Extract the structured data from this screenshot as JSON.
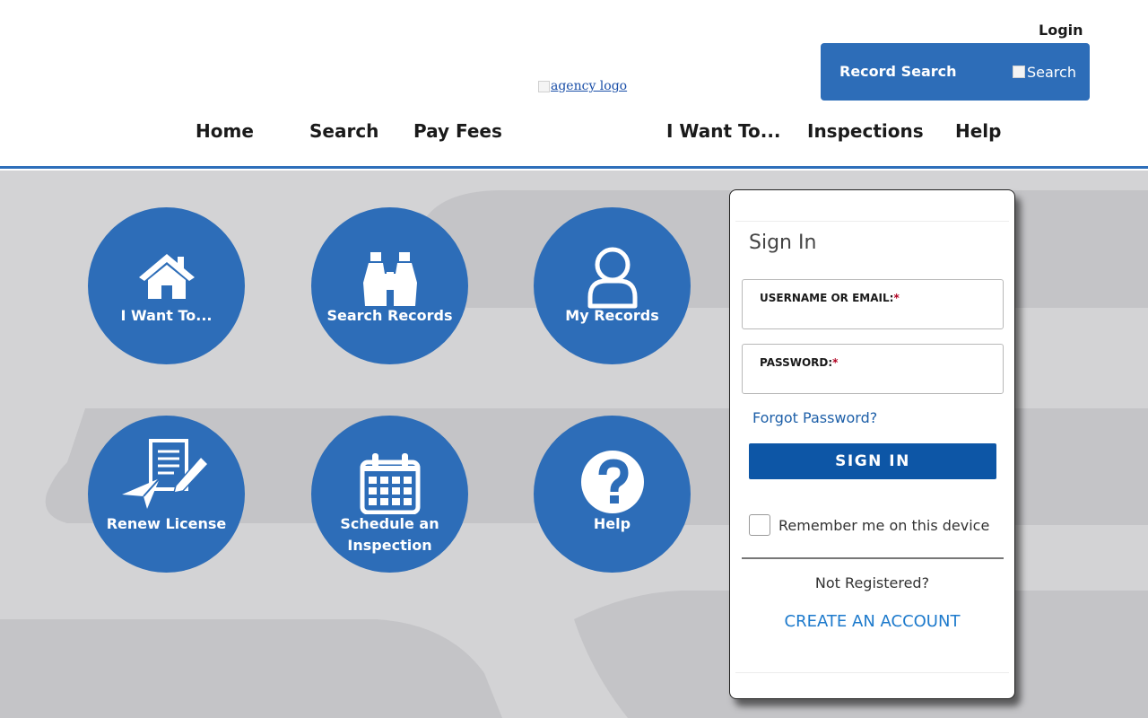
{
  "header": {
    "login_label": "Login",
    "record_search": {
      "label": "Record Search",
      "button_label": "Search"
    },
    "logo_alt": "agency logo",
    "nav": [
      {
        "label": "Home"
      },
      {
        "label": "Search"
      },
      {
        "label": "Pay Fees"
      },
      {
        "label": "I Want To..."
      },
      {
        "label": "Inspections"
      },
      {
        "label": "Help"
      }
    ]
  },
  "tiles": [
    {
      "label": "I Want To...",
      "icon": "house-icon"
    },
    {
      "label": "Search Records",
      "icon": "binoculars-icon"
    },
    {
      "label": "My Records",
      "icon": "user-icon"
    },
    {
      "label": "Renew License",
      "icon": "document-pen-icon"
    },
    {
      "label_line1": "Schedule an",
      "label_line2": "Inspection",
      "icon": "calendar-icon"
    },
    {
      "label": "Help",
      "icon": "question-icon"
    }
  ],
  "signin": {
    "title": "Sign In",
    "username_label": "USERNAME OR EMAIL:",
    "password_label": "PASSWORD:",
    "required_mark": "*",
    "forgot_password": "Forgot Password?",
    "signin_button": "SIGN IN",
    "remember_me": "Remember me on this device",
    "not_registered": "Not Registered?",
    "create_account": "CREATE AN ACCOUNT"
  },
  "colors": {
    "brand_blue": "#2d6db8",
    "button_blue": "#0d56a6",
    "link_blue": "#1d7acc",
    "background_gray": "#d3d3d5"
  }
}
